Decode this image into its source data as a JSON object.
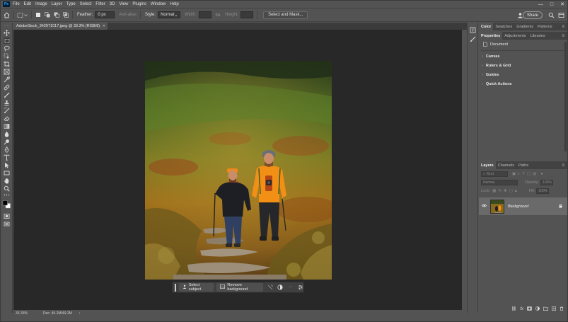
{
  "app": {
    "logo_text": "Ps"
  },
  "menu": [
    "File",
    "Edit",
    "Image",
    "Layer",
    "Type",
    "Select",
    "Filter",
    "3D",
    "View",
    "Plugins",
    "Window",
    "Help"
  ],
  "window_controls": {
    "minimize": "—",
    "maximize": "□",
    "close": "✕"
  },
  "options_bar": {
    "feather_label": "Feather:",
    "feather_value": "0 px",
    "anti_alias_label": "Anti-alias",
    "style_label": "Style:",
    "style_value": "Normal",
    "width_label": "Width:",
    "height_label": "Height:",
    "select_and_mask": "Select and Mask...",
    "share": "Share"
  },
  "document": {
    "tab_title": "AdobeStock_342971017.jpeg @ 33.3% (RGB/8)",
    "tab_close": "×"
  },
  "task_bar": {
    "select_subject": "Select subject",
    "remove_background": "Remove background",
    "more": "···"
  },
  "status_bar": {
    "zoom": "33.33%",
    "doc_size": "Doc: 49.2M/49.2M",
    "arrow": "›"
  },
  "panels": {
    "top_tabs": [
      "Color",
      "Swatches",
      "Gradients",
      "Patterns"
    ],
    "props_tabs": [
      "Properties",
      "Adjustments",
      "Libraries"
    ],
    "props_doc_label": "Document",
    "sections": [
      "Canvas",
      "Rulers & Grid",
      "Guides",
      "Quick Actions"
    ],
    "layers_tabs": [
      "Layers",
      "Channels",
      "Paths"
    ],
    "layers_filter_label": "Kind",
    "blend_mode": "Normal",
    "opacity_label": "Opacity:",
    "opacity_value": "100%",
    "lock_label": "Lock:",
    "fill_label": "Fill:",
    "fill_value": "100%",
    "layer_name": "Background",
    "panel_menu": "≡"
  },
  "colors": {
    "ui_bg": "#535353",
    "canvas_bg": "#282828",
    "tab_bg": "#3b3b3b",
    "ps_blue": "#31a8ff",
    "jacket_orange": "#f29016",
    "hat_orange": "#f58a0f"
  }
}
